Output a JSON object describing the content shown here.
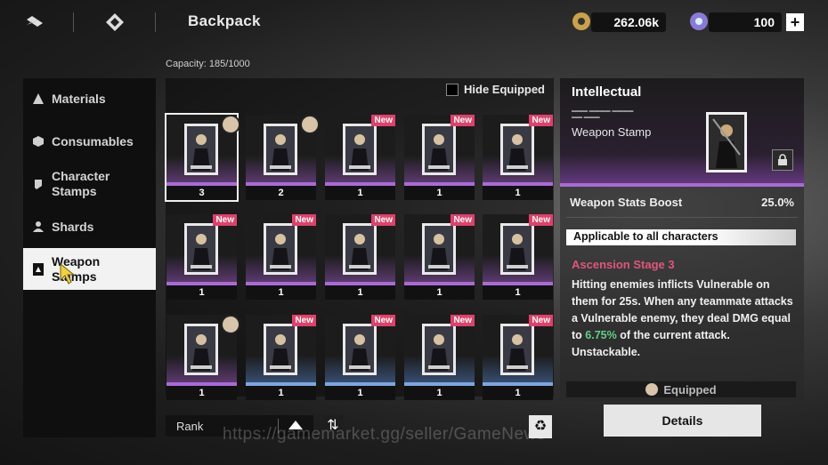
{
  "header": {
    "title": "Backpack",
    "capacity": "Capacity: 185/1000",
    "currency_gold": "262.06k",
    "currency_gem": "100",
    "plus_label": "+"
  },
  "sidebar": {
    "items": [
      {
        "label": "Materials",
        "icon": "flask-icon"
      },
      {
        "label": "Consumables",
        "icon": "hexagon-icon"
      },
      {
        "label": "Character Stamps",
        "icon": "stamp-icon"
      },
      {
        "label": "Shards",
        "icon": "person-icon"
      },
      {
        "label": "Weapon Stamps",
        "icon": "card-icon",
        "active": true
      }
    ]
  },
  "filter": {
    "hide_equipped": "Hide Equipped"
  },
  "items": [
    {
      "count": "3",
      "new": "",
      "badge": "avatar",
      "selected": true,
      "rarity": "purple"
    },
    {
      "count": "2",
      "new": "",
      "badge": "avatar",
      "rarity": "purple"
    },
    {
      "count": "1",
      "new": "New",
      "rarity": "purple"
    },
    {
      "count": "1",
      "new": "New",
      "rarity": "purple"
    },
    {
      "count": "1",
      "new": "New",
      "rarity": "purple"
    },
    {
      "count": "1",
      "new": "New",
      "rarity": "purple"
    },
    {
      "count": "1",
      "new": "New",
      "rarity": "purple"
    },
    {
      "count": "1",
      "new": "New",
      "rarity": "purple"
    },
    {
      "count": "1",
      "new": "New",
      "rarity": "purple"
    },
    {
      "count": "1",
      "new": "New",
      "rarity": "purple"
    },
    {
      "count": "1",
      "new": "",
      "badge": "avatar",
      "rarity": "purple"
    },
    {
      "count": "1",
      "new": "New",
      "rarity": "blue"
    },
    {
      "count": "1",
      "new": "New",
      "rarity": "blue"
    },
    {
      "count": "1",
      "new": "New",
      "rarity": "blue"
    },
    {
      "count": "1",
      "new": "New",
      "rarity": "blue"
    }
  ],
  "sort": {
    "label": "Rank"
  },
  "detail": {
    "name": "Intellectual",
    "type": "Weapon Stamp",
    "stat_label": "Weapon Stats Boost",
    "stat_value": "25.0%",
    "applicable": "Applicable to all characters",
    "ascension": "Ascension Stage 3",
    "desc_pre": "Hitting enemies inflicts Vulnerable on them for 25s. When any teammate attacks a Vulnerable enemy, they deal DMG equal to ",
    "desc_highlight": "6.75%",
    "desc_post": " of the current attack. Unstackable.",
    "equipped": "Equipped",
    "details_button": "Details"
  },
  "watermark": "https://gamemarket.gg/seller/GameNews",
  "colors": {
    "accent_purple": "#a96ad6",
    "accent_blue": "#7ea6e0",
    "new_badge": "#e0406a",
    "ascension": "#e0567a",
    "highlight_green": "#5fd08a"
  }
}
